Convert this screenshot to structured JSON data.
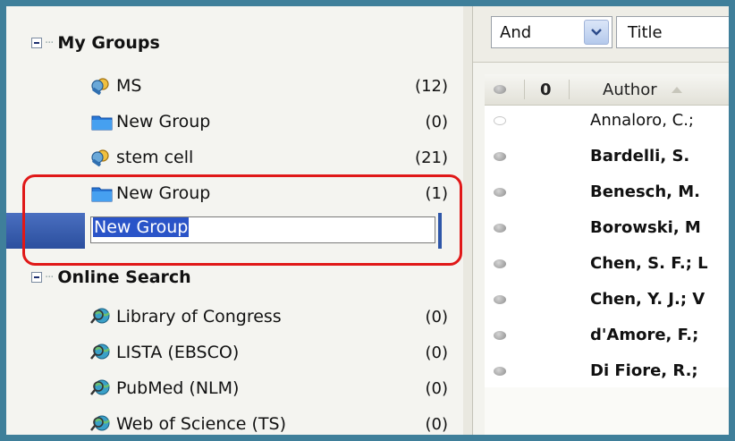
{
  "tree": {
    "my_groups": {
      "title": "My Groups",
      "items": [
        {
          "label": "MS",
          "count": "(12)",
          "icon": "smart-group-icon"
        },
        {
          "label": "New Group",
          "count": "(0)",
          "icon": "folder-icon"
        },
        {
          "label": "stem cell",
          "count": "(21)",
          "icon": "smart-group-icon"
        },
        {
          "label": "New Group",
          "count": "(1)",
          "icon": "folder-icon"
        }
      ],
      "edit_value": "New Group"
    },
    "online_search": {
      "title": "Online Search",
      "items": [
        {
          "label": "Library of Congress",
          "count": "(0)",
          "icon": "online-search-icon"
        },
        {
          "label": "LISTA (EBSCO)",
          "count": "(0)",
          "icon": "online-search-icon"
        },
        {
          "label": "PubMed (NLM)",
          "count": "(0)",
          "icon": "online-search-icon"
        },
        {
          "label": "Web of Science (TS)",
          "count": "(0)",
          "icon": "online-search-icon"
        }
      ]
    }
  },
  "search_bar": {
    "operator": "And",
    "field": "Title"
  },
  "reference_list": {
    "columns": {
      "attachment": "0",
      "author": "Author"
    },
    "rows": [
      {
        "author": "Annaloro, C.;",
        "bold": false,
        "read": true
      },
      {
        "author": "Bardelli, S.",
        "bold": true,
        "read": false
      },
      {
        "author": "Benesch, M.",
        "bold": true,
        "read": false
      },
      {
        "author": "Borowski, M",
        "bold": true,
        "read": false
      },
      {
        "author": "Chen, S. F.; L",
        "bold": true,
        "read": false
      },
      {
        "author": "Chen, Y. J.; V",
        "bold": true,
        "read": false
      },
      {
        "author": "d'Amore, F.;",
        "bold": true,
        "read": false
      },
      {
        "author": "Di Fiore, R.;",
        "bold": true,
        "read": false
      }
    ]
  },
  "colors": {
    "window_border": "#3f7f9a",
    "highlight": "#e01818",
    "selection": "#2a54c8"
  }
}
